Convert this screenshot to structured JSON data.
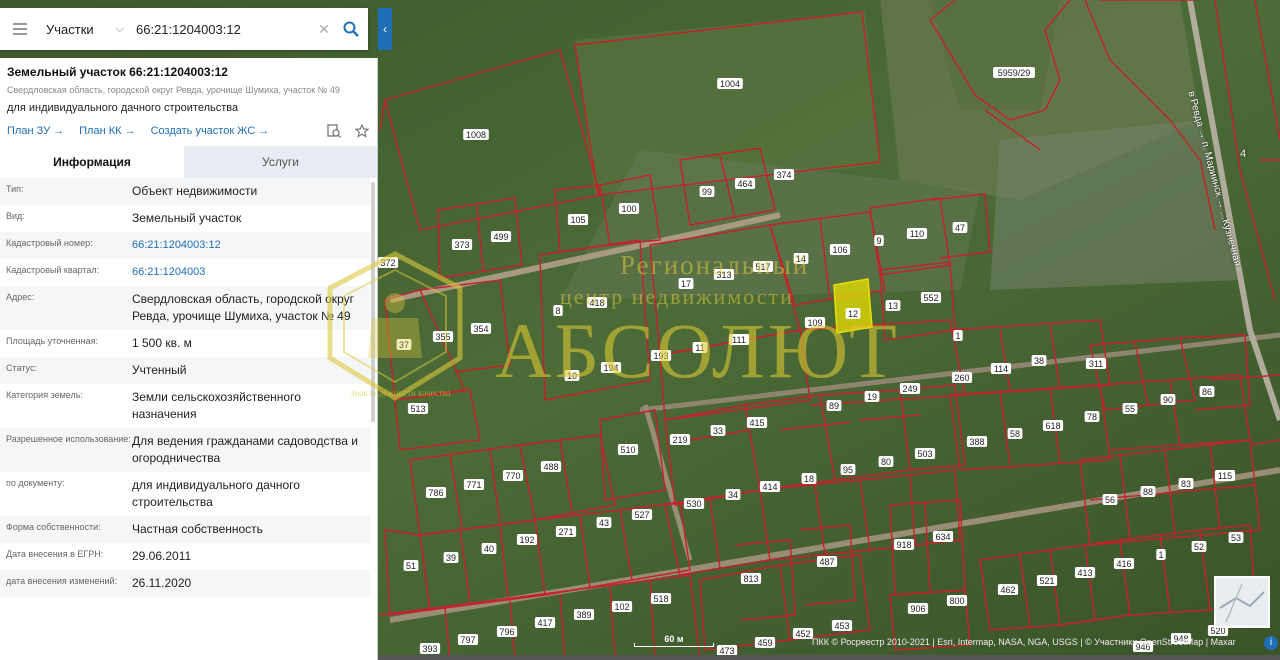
{
  "search": {
    "type_label": "Участки",
    "query": "66:21:1204003:12",
    "clear_glyph": "✕",
    "collapse_glyph": "‹"
  },
  "parcel": {
    "title": "Земельный участок 66:21:1204003:12",
    "address": "Свердловская область, городской округ Ревда, урочище Шумиха, участок № 49",
    "usage": "для индивидуального дачного строительства"
  },
  "links": [
    "План ЗУ →",
    "План КК →",
    "Создать участок ЖС →"
  ],
  "tabs": [
    "Информация",
    "Услуги"
  ],
  "properties": [
    {
      "key": "Тип:",
      "value": "Объект недвижимости"
    },
    {
      "key": "Вид:",
      "value": "Земельный участок"
    },
    {
      "key": "Кадастровый номер:",
      "value": "66:21:1204003:12",
      "link": true
    },
    {
      "key": "Кадастровый квартал:",
      "value": "66:21:1204003",
      "link": true
    },
    {
      "key": "Адрес:",
      "value": "Свердловская область, городской округ Ревда, урочище Шумиха, участок № 49"
    },
    {
      "key": "Площадь уточненная:",
      "value": "1 500 кв. м"
    },
    {
      "key": "Статус:",
      "value": "Учтенный"
    },
    {
      "key": "Категория земель:",
      "value": "Земли сельскохозяйственного назначения"
    },
    {
      "key": "Разрешенное использование:",
      "value": "Для ведения гражданами садоводства и огородничества"
    },
    {
      "key": "по документу:",
      "value": "для индивидуального дачного строительства"
    },
    {
      "key": "Форма собственности:",
      "value": "Частная собственность"
    },
    {
      "key": "Дата внесения в ЕГРН:",
      "value": "29.06.2011"
    },
    {
      "key": "дата внесения изменений:",
      "value": "26.11.2020"
    }
  ],
  "map": {
    "plot_labels": [
      "1004",
      "1008",
      "5959/29",
      "99",
      "464",
      "374",
      "105",
      "100",
      "373",
      "499",
      "372",
      "110",
      "47",
      "106",
      "9",
      "14",
      "517",
      "313",
      "17",
      "418",
      "552",
      "12",
      "13",
      "109",
      "1",
      "8",
      "354",
      "355",
      "37",
      "111",
      "193",
      "11",
      "260",
      "114",
      "38",
      "311",
      "10",
      "194",
      "249",
      "513",
      "19",
      "89",
      "415",
      "33",
      "219",
      "388",
      "58",
      "618",
      "78",
      "55",
      "90",
      "86",
      "510",
      "503",
      "80",
      "95",
      "18",
      "414",
      "34",
      "530",
      "488",
      "770",
      "771",
      "786",
      "527",
      "43",
      "271",
      "192",
      "40",
      "39",
      "51",
      "115",
      "83",
      "88",
      "56",
      "918",
      "634",
      "487",
      "813",
      "53",
      "52",
      "1",
      "416",
      "413",
      "521",
      "462",
      "518",
      "102",
      "389",
      "417",
      "796",
      "797",
      "393",
      "906",
      "800",
      "453",
      "452",
      "459",
      "473",
      "946",
      "948",
      "520"
    ],
    "road_labels": [
      "в Ревда → п. Мариинск → ...Кузнечная",
      "4"
    ],
    "scale_label": "60 м",
    "attribution": "ПКК © Росреестр 2010-2021 | Esri, Intermap, NASA, NGA, USGS | © Участники OpenStreetMap | Maxar",
    "highlight_color": "#e8e000",
    "boundary_color": "#c8202a"
  },
  "watermark": {
    "line1": "Региональный",
    "line2": "центр недвижимости",
    "line3": "АБСОЛЮТ",
    "emblem_text": "Знак надёжности качества"
  }
}
